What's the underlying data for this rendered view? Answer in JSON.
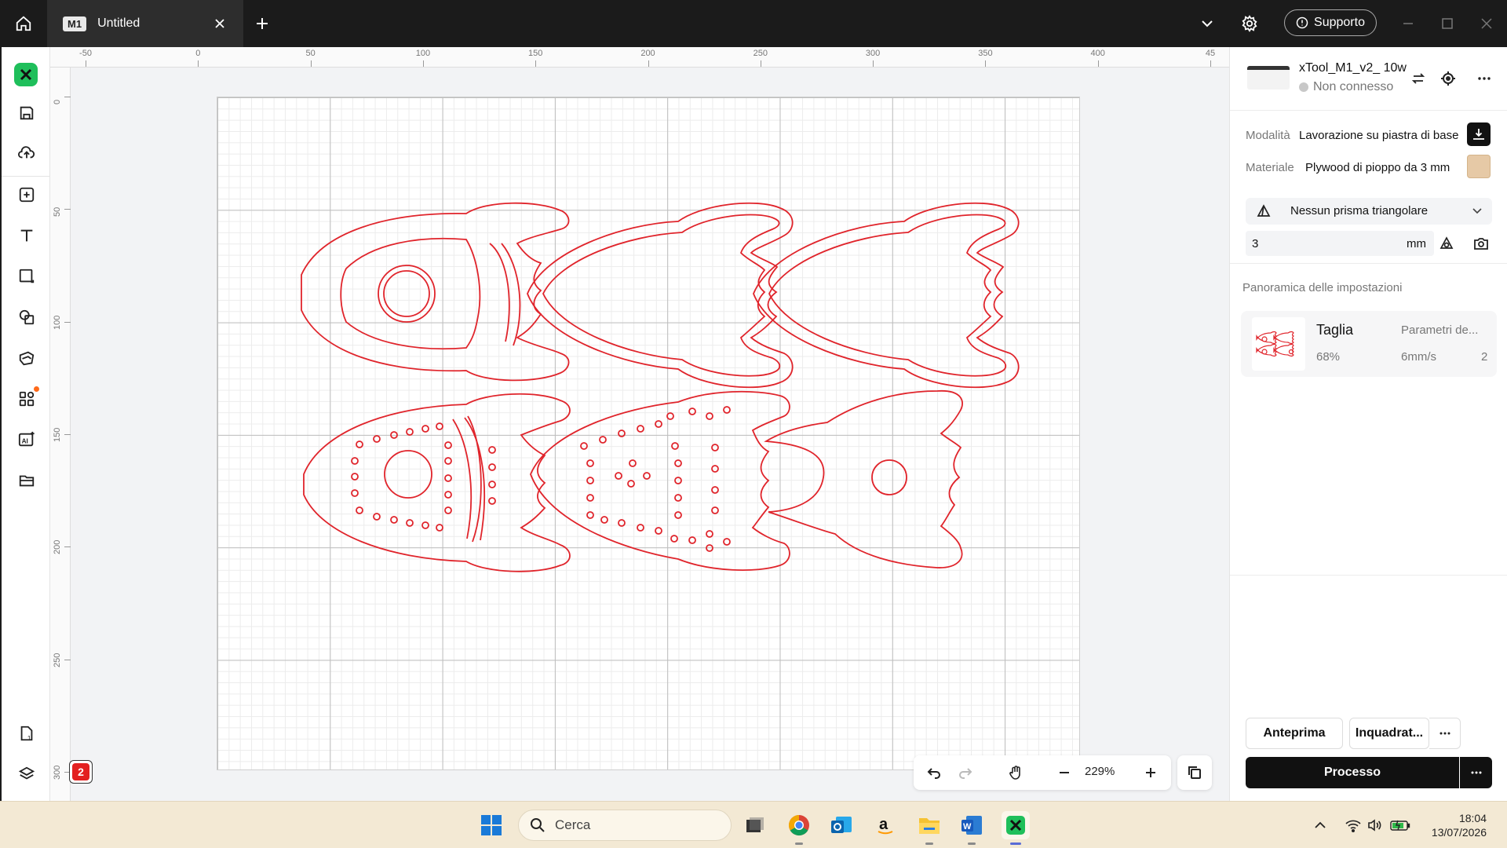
{
  "titlebar": {
    "tab_badge": "M1",
    "tab_title": "Untitled",
    "support_label": "Supporto"
  },
  "rulers": {
    "x_labels": [
      "-50",
      "0",
      "50",
      "100",
      "150",
      "200",
      "250",
      "300",
      "350",
      "400",
      "45"
    ],
    "y_labels": [
      "0",
      "50",
      "100",
      "150",
      "200",
      "250",
      "300"
    ]
  },
  "canvas": {
    "zoom": "229%",
    "layers_count": "2",
    "stroke_color": "#e0242b"
  },
  "device": {
    "name": "xTool_M1_v2_ 10w",
    "status": "Non connesso"
  },
  "settings": {
    "mode_label": "Modalità",
    "mode_value": "Lavorazione su piastra di base",
    "material_label": "Materiale",
    "material_value": "Plywood di pioppo da 3 mm",
    "material_color": "#e6c9a6",
    "prism_value": "Nessun prisma triangolare",
    "thickness_value": "3",
    "thickness_unit": "mm"
  },
  "overview": {
    "title": "Panoramica delle impostazioni",
    "card_title": "Taglia",
    "card_params": "Parametri de...",
    "power": "68%",
    "speed": "6mm/s",
    "passes": "2"
  },
  "actions": {
    "preview": "Anteprima",
    "framing": "Inquadrat...",
    "process": "Processo"
  },
  "taskbar": {
    "search_placeholder": "Cerca",
    "time": "18:04",
    "date": "13/07/2026"
  }
}
